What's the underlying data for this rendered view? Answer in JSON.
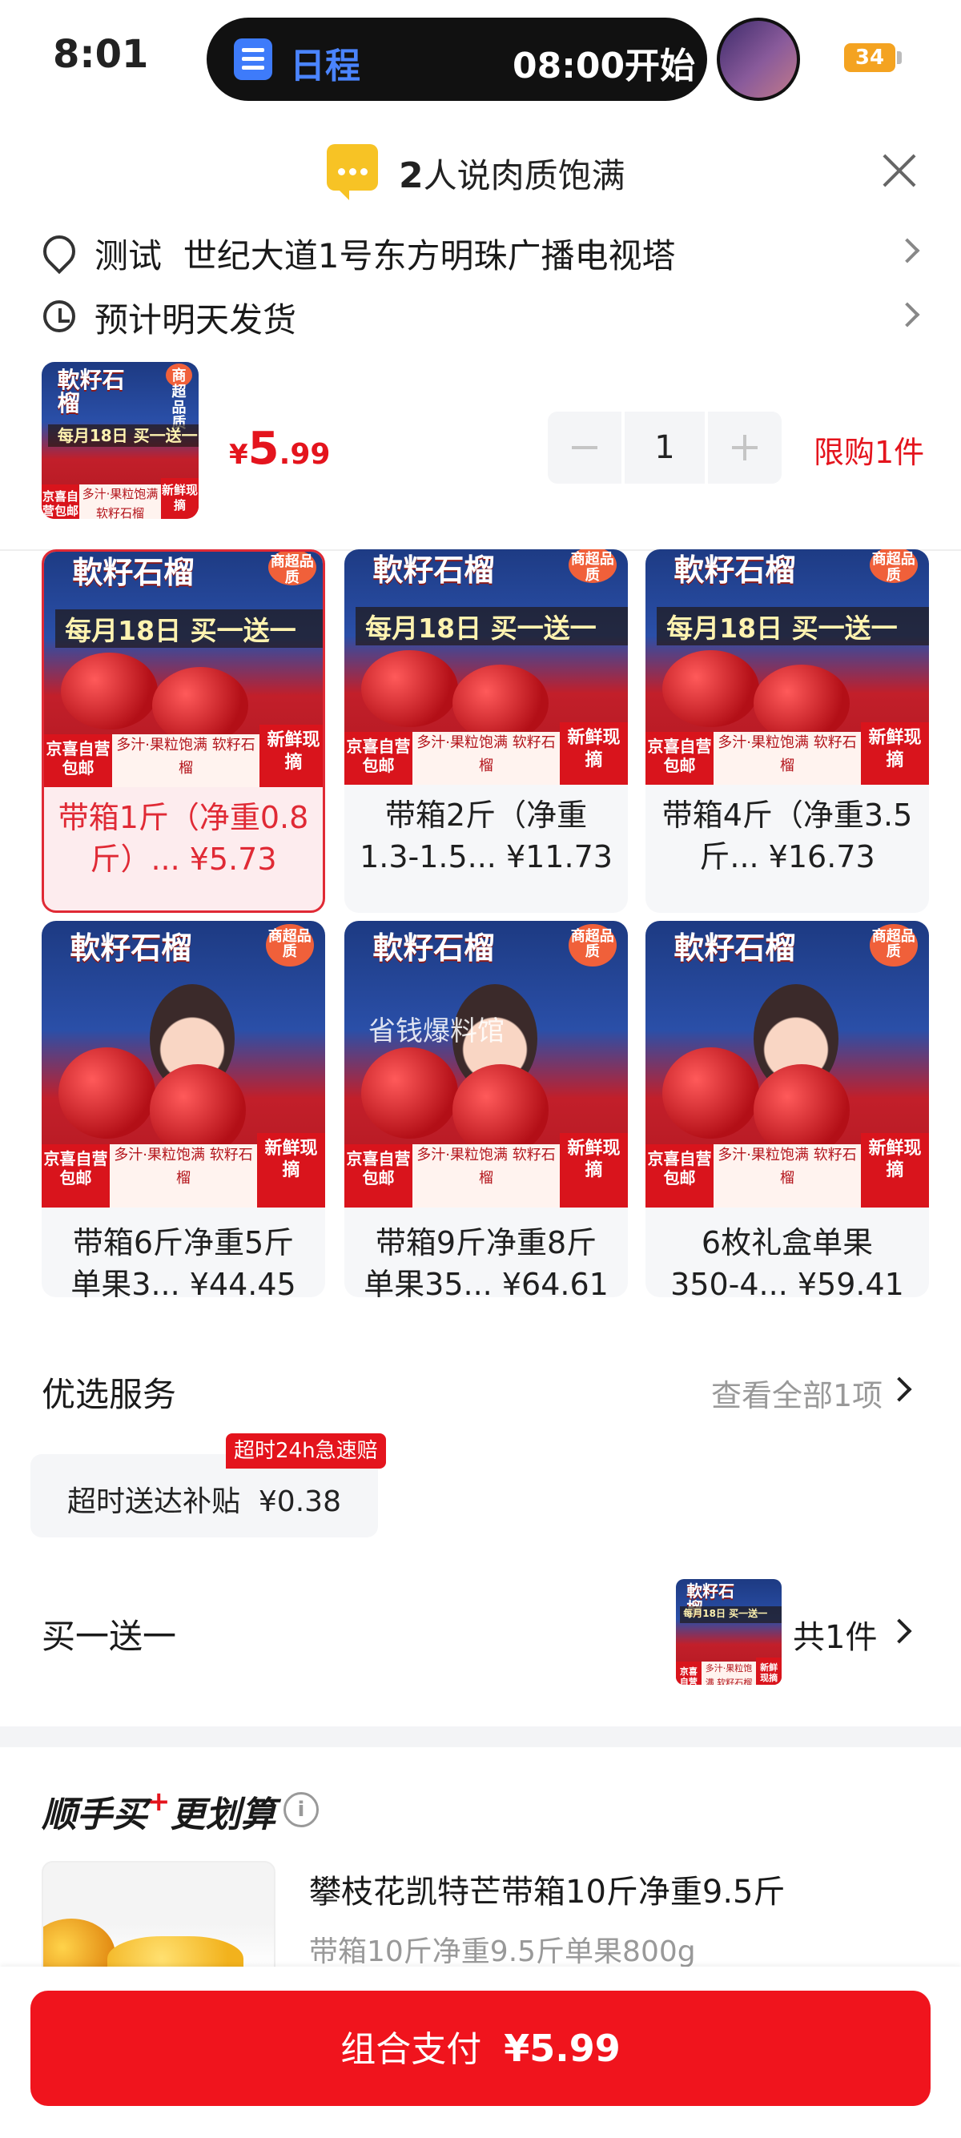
{
  "status_bar": {
    "time": "8:01",
    "island_title": "日程",
    "island_time": "08:00开始",
    "battery": "34"
  },
  "review": {
    "count": "2",
    "text": "人说肉质饱满"
  },
  "address": {
    "name": "测试",
    "detail": "世纪大道1号东方明珠广播电视塔",
    "shipping": "预计明天发货"
  },
  "product": {
    "thumb": {
      "title": "軟籽石榴",
      "band": "每月18日 买一送一",
      "tag_left": "京喜自营包邮",
      "tag_mid": "多汁·果粒饱满 软籽石榴",
      "tag_right": "新鲜现摘",
      "badge": "商超品质"
    },
    "price_currency": "¥",
    "price_int": "5",
    "price_dec": ".99",
    "quantity": "1",
    "limit": "限购1件"
  },
  "variants": [
    {
      "label_line1": "带箱1斤（净重0.8",
      "label_line2": "斤）...  ¥5.73",
      "selected": true
    },
    {
      "label_line1": "带箱2斤（净重",
      "label_line2": "1.3-1.5...  ¥11.73",
      "selected": false
    },
    {
      "label_line1": "带箱4斤（净重3.5",
      "label_line2": "斤...  ¥16.73",
      "selected": false
    },
    {
      "label_line1": "带箱6斤净重5斤",
      "label_line2": "单果3...  ¥44.45",
      "selected": false
    },
    {
      "label_line1": "带箱9斤净重8斤",
      "label_line2": "单果35...  ¥64.61",
      "selected": false
    },
    {
      "label_line1": "6枚礼盒单果",
      "label_line2": "350-4...  ¥59.41",
      "selected": false
    }
  ],
  "watermark": "省钱爆料馆",
  "services": {
    "title": "优选服务",
    "view_all": "查看全部1项",
    "chip_label": "超时送达补贴",
    "chip_price": "¥0.38",
    "chip_badge": "超时24h急速赔"
  },
  "bogo": {
    "title": "买一送一",
    "count": "共1件"
  },
  "bundle": {
    "title_a": "顺手买",
    "title_b": "更划算",
    "info": "i",
    "item_name": "攀枝花凯特芒带箱10斤净重9.5斤",
    "item_spec": "带箱10斤净重9.5斤单果800g"
  },
  "pay": {
    "label": "组合支付",
    "amount": "¥5.99"
  },
  "colors": {
    "accent_red": "#e4141d",
    "island_blue": "#4a84ff",
    "battery": "#f4a321"
  }
}
